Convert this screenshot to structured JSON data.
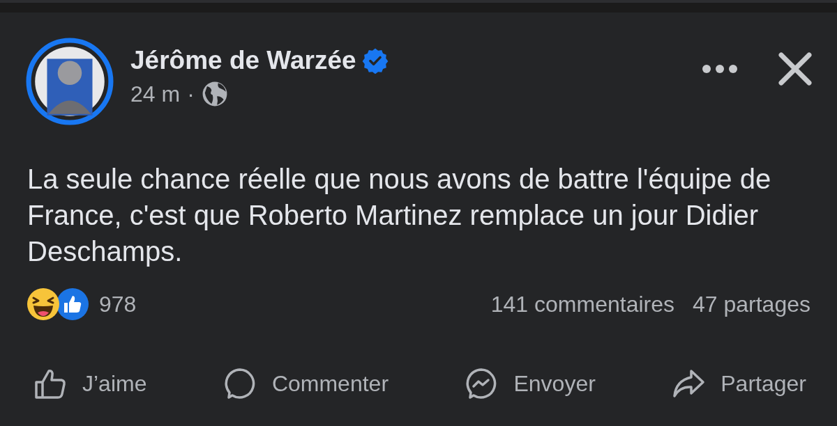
{
  "post": {
    "author": "Jérôme de Warzée",
    "verified": true,
    "time": "24 m",
    "separator": "·",
    "text": "La seule chance réelle que nous avons de battre l'équipe de France, c'est que Roberto Martinez remplace un jour Didier Deschamps."
  },
  "reactions": {
    "types": [
      {
        "kind": "haha"
      },
      {
        "kind": "like"
      }
    ],
    "count": "978"
  },
  "stats": [
    "141 commentaires",
    "47 partages"
  ],
  "actions": [
    {
      "kind": "like",
      "label": "J’aime"
    },
    {
      "kind": "comment",
      "label": "Commenter"
    },
    {
      "kind": "send",
      "label": "Envoyer"
    },
    {
      "kind": "share",
      "label": "Partager"
    }
  ]
}
